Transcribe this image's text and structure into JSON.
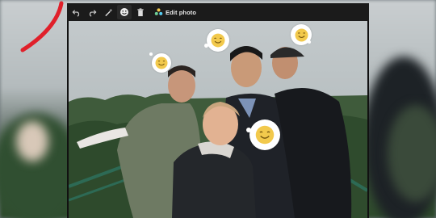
{
  "toolbar": {
    "edit_photo_label": "Edit photo",
    "icons": [
      "undo-icon",
      "redo-icon",
      "magic-wand-icon",
      "smiley-icon",
      "trash-icon",
      "edit-photo-icon"
    ]
  },
  "colors": {
    "arrow": "#e0202a",
    "toolbar_bg": "#1b1b1b",
    "sticker_face": "#f2c94c"
  },
  "photo": {
    "stickers": [
      "sticker-face",
      "sticker-face",
      "sticker-face",
      "sticker-face"
    ]
  }
}
